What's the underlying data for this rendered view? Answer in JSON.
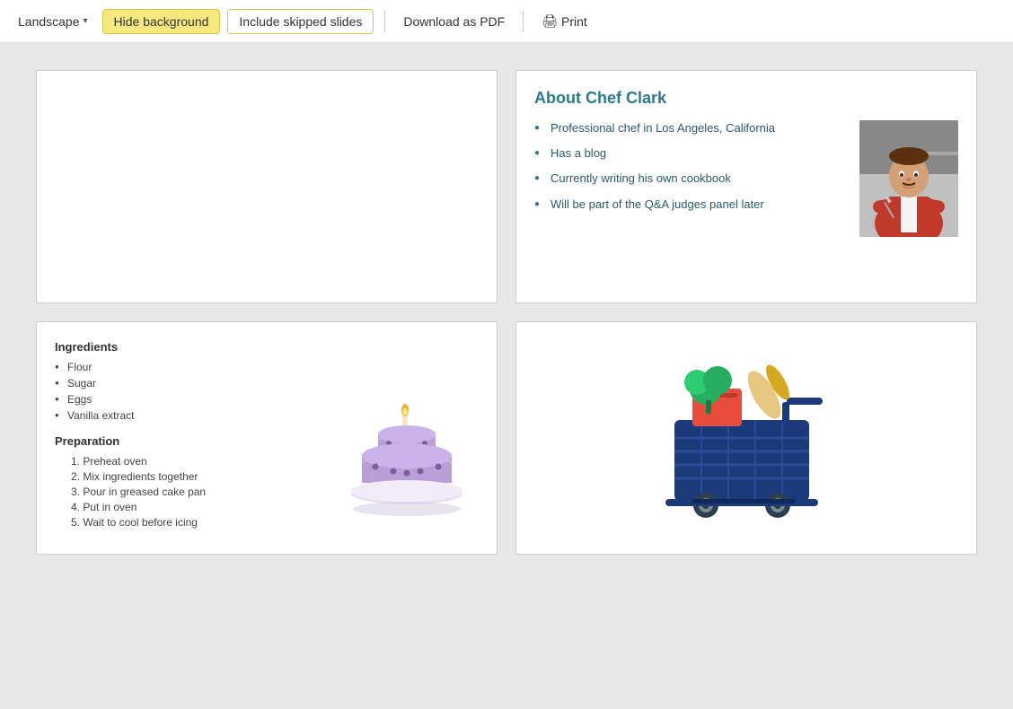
{
  "toolbar": {
    "landscape_label": "Landscape",
    "hide_background_label": "Hide background",
    "include_skipped_label": "Include skipped slides",
    "download_pdf_label": "Download as PDF",
    "print_label": "Print"
  },
  "slides": {
    "slide1": {
      "content": ""
    },
    "slide2": {
      "title": "About Chef Clark",
      "bullets": [
        "Professional chef in Los Angeles, California",
        "Has a blog",
        "Currently writing his own cookbook",
        "Will be part of the Q&A judges panel later"
      ]
    },
    "slide3": {
      "ingredients_title": "Ingredients",
      "ingredients": [
        "Flour",
        "Sugar",
        "Eggs",
        "Vanilla extract"
      ],
      "preparation_title": "Preparation",
      "steps": [
        "Preheat oven",
        "Mix ingredients together",
        "Pour in greased cake pan",
        "Put in oven",
        "Wait to cool before icing"
      ]
    },
    "slide4": {
      "content": ""
    }
  }
}
